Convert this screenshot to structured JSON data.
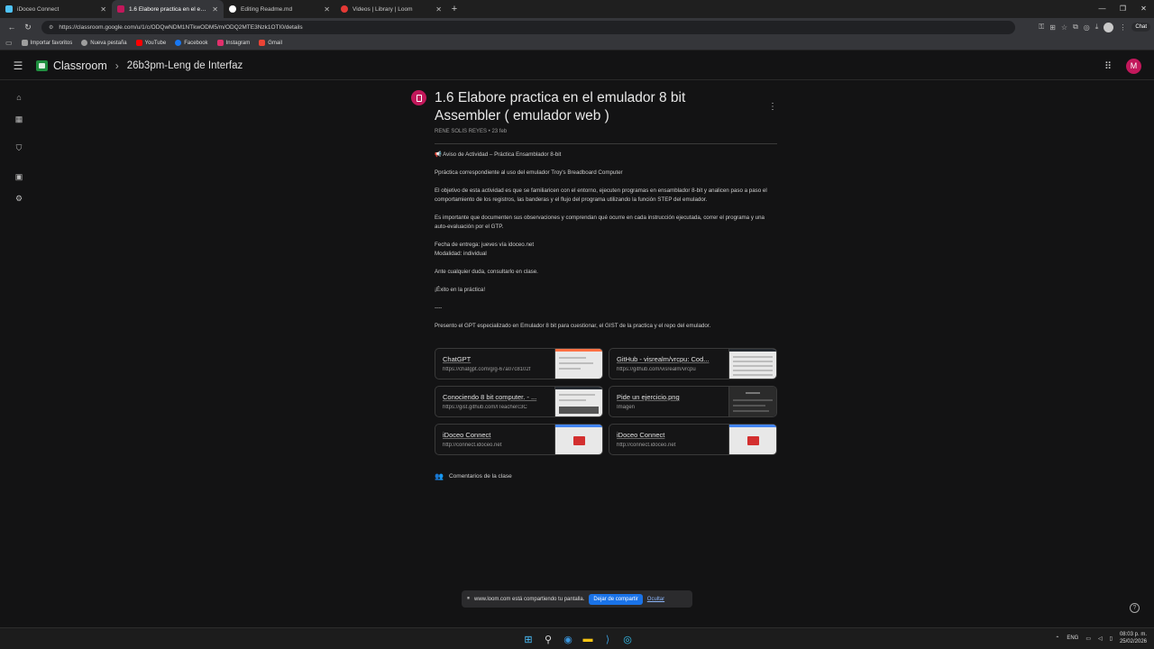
{
  "browser": {
    "tabs": [
      {
        "title": "iDoceo Connect",
        "active": false,
        "favicon_color": "#4fc3f7"
      },
      {
        "title": "1.6 Elabore practica en el emulado",
        "active": true,
        "favicon_color": "#c2185b"
      },
      {
        "title": "Editing Readme.md",
        "active": false,
        "favicon_color": "#ffffff"
      },
      {
        "title": "Videos | Library | Loom",
        "active": false,
        "favicon_color": "#e53935"
      }
    ],
    "url": "https://classroom.google.com/u/1/c/ODQwNDM1NTkwODM5/m/ODQ2MTE3Nzk1OTI0/details",
    "chat_label": "Chat",
    "bookmarks": [
      {
        "label": "Importar favoritos",
        "color": "#9e9e9e"
      },
      {
        "label": "Nueva pestaña",
        "color": "#9e9e9e"
      },
      {
        "label": "YouTube",
        "color": "#ff0000"
      },
      {
        "label": "Facebook",
        "color": "#1877f2"
      },
      {
        "label": "Instagram",
        "color": "#e1306c"
      },
      {
        "label": "Gmail",
        "color": "#ea4335"
      }
    ]
  },
  "header": {
    "app_name": "Classroom",
    "course": "26b3pm-Leng de Interfaz",
    "avatar_letter": "M"
  },
  "assignment": {
    "title": "1.6 Elabore practica en el emulador 8 bit Assembler ( emulador web )",
    "meta": "RENE SOLIS REYES • 23 feb",
    "body": {
      "heading": "📢 Aviso de Actividad – Práctica Ensamblador 8-bit",
      "p1": "Ppráctica correspondiente al uso del emulador Troy's Breadboard Computer",
      "p2": "El objetivo de esta actividad es que se familiaricen con el entorno, ejecuten programas en ensamblador 8-bit y analicen paso a paso el comportamiento de los registros, las banderas y el flujo del programa utilizando la función STEP del emulador.",
      "p3": "Es importante que documenten sus observaciones y comprendan qué ocurre en cada instrucción ejecutada, correr el programa y una auto-evaluación por el GTP.",
      "p4a": "Fecha de entrega: jueves vía idoceo.net",
      "p4b": "Modalidad: individual",
      "p5": "Ante cualquier duda, consultarlo en clase.",
      "p6": "¡Éxito en la práctica!",
      "sep": "----",
      "p7": "Presento el GPT especializado en Emulador 8 bit para cuestionar, el GIST de la practica y el repo del emulador."
    },
    "attachments": [
      {
        "title": "ChatGPT",
        "sub": "https://chatgpt.com/g/g-67a07c8102f"
      },
      {
        "title": "GitHub - visrealm/vrcpu: Cod...",
        "sub": "https://github.com/visrealm/vrcpu"
      },
      {
        "title": "Conociendo 8 bit computer. - ...",
        "sub": "https://gist.github.com/ITeacherc3C"
      },
      {
        "title": "Pide un ejercicio.png",
        "sub": "Imagen"
      },
      {
        "title": "iDoceo Connect",
        "sub": "http://connect.idoceo.net"
      },
      {
        "title": "iDoceo Connect",
        "sub": "http://connect.idoceo.net"
      }
    ],
    "comments_label": "Comentarios de la clase"
  },
  "sharing": {
    "message": "www.loom.com está compartiendo tu pantalla.",
    "stop_label": "Dejar de compartir",
    "hide_label": "Ocultar"
  },
  "taskbar": {
    "lang": "ENG",
    "time": "08:03 p. m.",
    "date": "25/02/2026"
  },
  "colors": {
    "accent": "#c2185b",
    "classroom_green": "#1e8e3e",
    "share_blue": "#1a73e8"
  }
}
